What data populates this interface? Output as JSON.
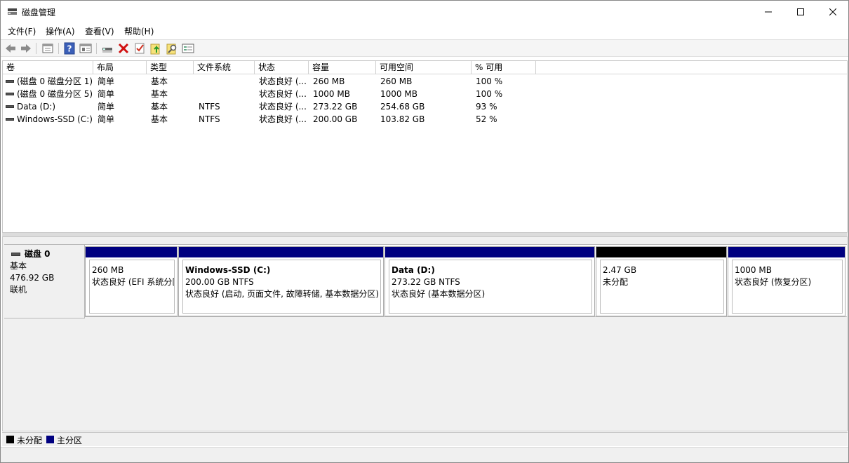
{
  "window": {
    "title": "磁盘管理"
  },
  "menu": [
    "文件(F)",
    "操作(A)",
    "查看(V)",
    "帮助(H)"
  ],
  "columns": [
    "卷",
    "布局",
    "类型",
    "文件系统",
    "状态",
    "容量",
    "可用空间",
    "% 可用"
  ],
  "volumes": [
    {
      "name": "(磁盘 0 磁盘分区 1)",
      "layout": "简单",
      "type": "基本",
      "fs": "",
      "status": "状态良好 (...",
      "capacity": "260 MB",
      "free": "260 MB",
      "pct": "100 %"
    },
    {
      "name": "(磁盘 0 磁盘分区 5)",
      "layout": "简单",
      "type": "基本",
      "fs": "",
      "status": "状态良好 (...",
      "capacity": "1000 MB",
      "free": "1000 MB",
      "pct": "100 %"
    },
    {
      "name": "Data (D:)",
      "layout": "简单",
      "type": "基本",
      "fs": "NTFS",
      "status": "状态良好 (...",
      "capacity": "273.22 GB",
      "free": "254.68 GB",
      "pct": "93 %"
    },
    {
      "name": "Windows-SSD (C:)",
      "layout": "简单",
      "type": "基本",
      "fs": "NTFS",
      "status": "状态良好 (...",
      "capacity": "200.00 GB",
      "free": "103.82 GB",
      "pct": "52 %"
    }
  ],
  "disk": {
    "name": "磁盘 0",
    "type": "基本",
    "size": "476.92 GB",
    "state": "联机"
  },
  "partitions": [
    {
      "name": "",
      "size": "260 MB",
      "status": "状态良好 (EFI 系统分区)",
      "kind": "primary"
    },
    {
      "name": "Windows-SSD  (C:)",
      "size": "200.00 GB NTFS",
      "status": "状态良好 (启动, 页面文件, 故障转储, 基本数据分区)",
      "kind": "primary"
    },
    {
      "name": "Data  (D:)",
      "size": "273.22 GB NTFS",
      "status": "状态良好 (基本数据分区)",
      "kind": "primary"
    },
    {
      "name": "",
      "size": "2.47 GB",
      "status": "未分配",
      "kind": "unallocated"
    },
    {
      "name": "",
      "size": "1000 MB",
      "status": "状态良好 (恢复分区)",
      "kind": "primary"
    }
  ],
  "legend": {
    "unallocated": "未分配",
    "primary": "主分区"
  },
  "colors": {
    "primary": "#000080",
    "unallocated": "#000000"
  },
  "toolbar_icons": [
    "back-icon",
    "forward-icon",
    "up-level-icon",
    "help-icon",
    "properties-icon",
    "connect-icon",
    "delete-icon",
    "check-icon",
    "export-icon",
    "search-icon",
    "console-icon"
  ]
}
